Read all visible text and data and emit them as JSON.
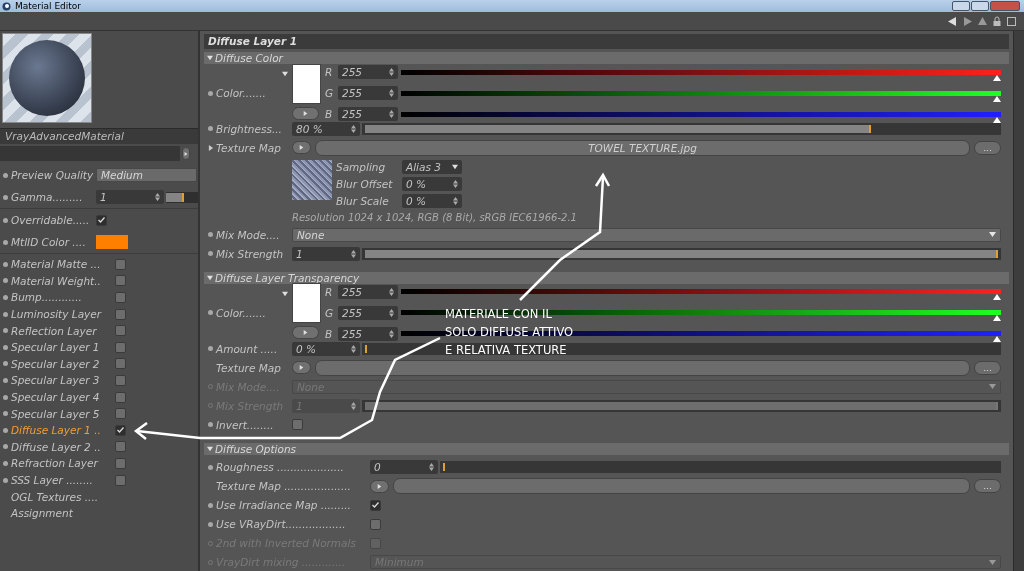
{
  "window": {
    "title": "Material Editor"
  },
  "preview": {
    "material_name": "VrayAdvancedMaterial"
  },
  "left_params": [
    {
      "kind": "dropdown",
      "label": "Preview Quality",
      "value": "Medium"
    },
    {
      "kind": "slider",
      "label": "Gamma.........",
      "value": "1",
      "level": 0.55
    },
    {
      "kind": "checkbox",
      "label": "Overridable.....",
      "checked": true
    },
    {
      "kind": "color",
      "label": "MtlID Color ....",
      "color": "#ff8000"
    }
  ],
  "channels": [
    {
      "kind": "checkbox",
      "label": "Material Matte ...",
      "checked": false,
      "selected": false
    },
    {
      "kind": "checkbox",
      "label": "Material Weight..",
      "checked": false,
      "selected": false
    },
    {
      "kind": "checkbox",
      "label": "Bump............",
      "checked": false,
      "selected": false
    },
    {
      "kind": "checkbox",
      "label": "Luminosity Layer",
      "checked": false,
      "selected": false
    },
    {
      "kind": "checkbox",
      "label": "Reflection Layer",
      "checked": false,
      "selected": false
    },
    {
      "kind": "checkbox",
      "label": "Specular Layer 1",
      "checked": false,
      "selected": false
    },
    {
      "kind": "checkbox",
      "label": "Specular Layer 2",
      "checked": false,
      "selected": false
    },
    {
      "kind": "checkbox",
      "label": "Specular Layer 3",
      "checked": false,
      "selected": false
    },
    {
      "kind": "checkbox",
      "label": "Specular Layer 4",
      "checked": false,
      "selected": false
    },
    {
      "kind": "checkbox",
      "label": "Specular Layer 5",
      "checked": false,
      "selected": false
    },
    {
      "kind": "checkbox",
      "label": "Diffuse Layer 1 ..",
      "checked": true,
      "selected": true
    },
    {
      "kind": "checkbox",
      "label": "Diffuse Layer 2 ..",
      "checked": false,
      "selected": false
    },
    {
      "kind": "checkbox",
      "label": "Refraction Layer",
      "checked": false,
      "selected": false
    },
    {
      "kind": "checkbox",
      "label": "SSS Layer ........",
      "checked": false,
      "selected": false
    },
    {
      "kind": "link",
      "label": "OGL Textures ....",
      "selected": false
    },
    {
      "kind": "link",
      "label": "Assignment",
      "selected": false
    }
  ],
  "panel_title": "Diffuse Layer 1",
  "sections": [
    {
      "title": "Diffuse Color",
      "rows": [
        {
          "kind": "color",
          "label": "Color.......",
          "channels": [
            {
              "name": "R",
              "value": "255",
              "level": 1
            },
            {
              "name": "G",
              "value": "255",
              "level": 1
            },
            {
              "name": "B",
              "value": "255",
              "level": 1
            }
          ]
        },
        {
          "kind": "slider",
          "label": "Brightness...",
          "value": "80 %",
          "level": 0.8,
          "disabled": false
        },
        {
          "kind": "texture",
          "label": "Texture Map",
          "file": "TOWEL TEXTURE.jpg",
          "browse_label": "...",
          "details": {
            "fields": [
              {
                "label": "Sampling",
                "value": "Alias 3",
                "kind": "dropdown"
              },
              {
                "label": "Blur Offset",
                "value": "0 %",
                "kind": "spinner"
              },
              {
                "label": "Blur Scale",
                "value": "0 %",
                "kind": "spinner"
              }
            ],
            "info": "Resolution 1024 x 1024, RGB (8 Bit), sRGB IEC61966-2.1"
          }
        },
        {
          "kind": "dropdown",
          "label": "Mix Mode....",
          "value": "None",
          "disabled": false
        },
        {
          "kind": "slider",
          "label": "Mix Strength",
          "value": "1",
          "level": 1,
          "disabled": false
        }
      ]
    },
    {
      "title": "Diffuse Layer Transparency",
      "rows": [
        {
          "kind": "color",
          "label": "Color.......",
          "channels": [
            {
              "name": "R",
              "value": "255",
              "level": 1
            },
            {
              "name": "G",
              "value": "255",
              "level": 1
            },
            {
              "name": "B",
              "value": "255",
              "level": 1
            }
          ]
        },
        {
          "kind": "slider",
          "label": "Amount .....",
          "value": "0 %",
          "level": 0,
          "disabled": false
        },
        {
          "kind": "texture",
          "label": "Texture Map",
          "browse_label": "..."
        },
        {
          "kind": "dropdown",
          "label": "Mix Mode....",
          "value": "None",
          "disabled": true
        },
        {
          "kind": "slider",
          "label": "Mix Strength",
          "value": "1",
          "level": 1,
          "disabled": true
        },
        {
          "kind": "checkbox",
          "label": "Invert........",
          "checked": false,
          "disabled": false
        }
      ]
    },
    {
      "title": "Diffuse Options",
      "rows": [
        {
          "kind": "slider",
          "label": "Roughness ....................",
          "value": "0",
          "level": 0,
          "disabled": false
        },
        {
          "kind": "texture",
          "label": "Texture Map ....................",
          "browse_label": "..."
        },
        {
          "kind": "checkbox",
          "label": "Use Irradiance Map .........",
          "checked": true,
          "disabled": false
        },
        {
          "kind": "checkbox",
          "label": "Use VRayDirt..................",
          "checked": false,
          "disabled": false
        },
        {
          "kind": "checkbox",
          "label": "2nd with Inverted Normals",
          "checked": false,
          "disabled": true
        },
        {
          "kind": "dropdown",
          "label": "VrayDirt mixing .............",
          "value": "Minimum",
          "disabled": true
        }
      ]
    }
  ],
  "annotation": {
    "lines": [
      "MATERIALE CON IL",
      "SOLO DIFFUSE ATTIVO",
      "E RELATIVA TEXTURE"
    ]
  }
}
